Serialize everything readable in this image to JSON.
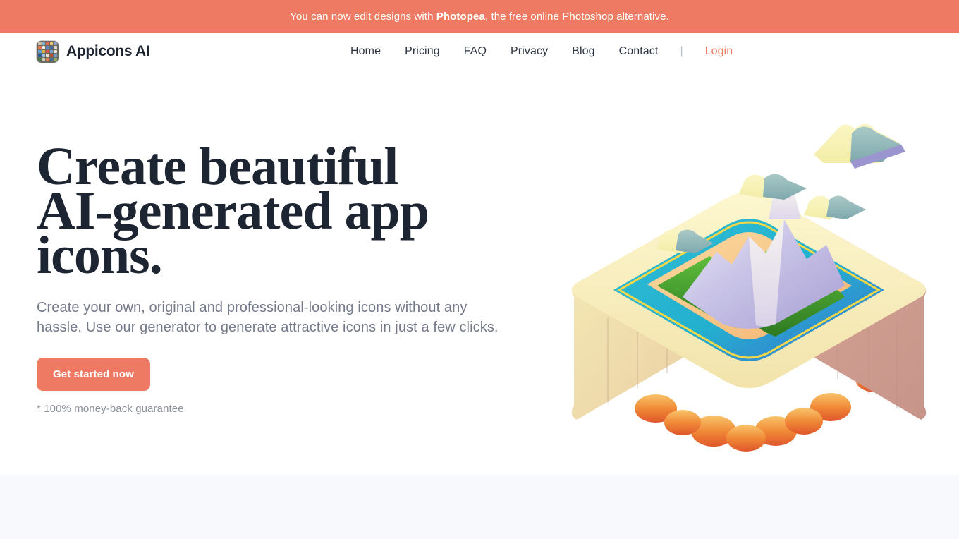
{
  "promo": {
    "prefix": "You can now edit designs with ",
    "brand": "Photopea",
    "suffix": ", the free online Photoshop alternative.",
    "background_color": "#ef7a63",
    "text_color": "#ffffff"
  },
  "header": {
    "brand_name": "Appicons AI",
    "logo_icon": "app-grid-icon",
    "nav": [
      {
        "label": "Home",
        "name": "home"
      },
      {
        "label": "Pricing",
        "name": "pricing"
      },
      {
        "label": "FAQ",
        "name": "faq"
      },
      {
        "label": "Privacy",
        "name": "privacy"
      },
      {
        "label": "Blog",
        "name": "blog"
      },
      {
        "label": "Contact",
        "name": "contact"
      }
    ],
    "separator": "|",
    "login_label": "Login",
    "login_color": "#ef7a63"
  },
  "hero": {
    "title_line1": "Create beautiful",
    "title_line2": "AI-generated app",
    "title_line3": "icons.",
    "title_color": "#1e2532",
    "subtitle": "Create your own, original and professional-looking icons without any hassle. Use our generator to generate attractive icons in just a few clicks.",
    "subtitle_color": "#74798a",
    "cta_label": "Get started now",
    "cta_color": "#ef7a63",
    "guarantee": "* 100% money-back guarantee",
    "illustration": "3d-isometric-volcano-island-icon"
  },
  "colors": {
    "accent": "#ef7a63",
    "ink": "#1e2532",
    "muted": "#74798a",
    "band": "#f8f9fc",
    "page": "#ffffff"
  }
}
